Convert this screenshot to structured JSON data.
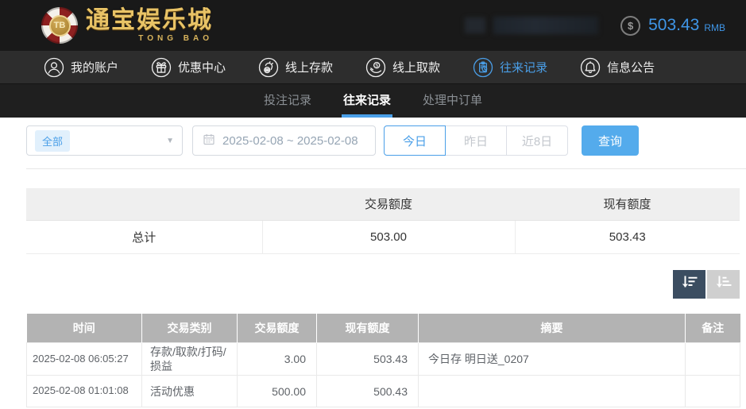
{
  "brand": {
    "chip_text": "TB",
    "name": "通宝娱乐城",
    "name_en": "TONG BAO"
  },
  "topbar": {
    "balance": "503.43",
    "currency": "RMB"
  },
  "nav": {
    "items": [
      {
        "label": "我的账户",
        "icon": "user-icon",
        "active": false
      },
      {
        "label": "优惠中心",
        "icon": "gift-icon",
        "active": false
      },
      {
        "label": "线上存款",
        "icon": "deposit-hand-coin-icon",
        "active": false
      },
      {
        "label": "线上取款",
        "icon": "withdraw-hand-coin-icon",
        "active": false
      },
      {
        "label": "往来记录",
        "icon": "transfer-records-icon",
        "active": true
      },
      {
        "label": "信息公告",
        "icon": "bell-icon",
        "active": false
      }
    ]
  },
  "subnav": {
    "tabs": [
      {
        "label": "投注记录",
        "active": false
      },
      {
        "label": "往来记录",
        "active": true
      },
      {
        "label": "处理中订单",
        "active": false
      }
    ]
  },
  "filters": {
    "type_select": {
      "value": "全部",
      "caret_icon": "caret-down-icon"
    },
    "date_range": {
      "value": "2025-02-08 ~ 2025-02-08",
      "icon": "calendar-icon"
    },
    "quick_ranges": [
      {
        "label": "今日",
        "active": true
      },
      {
        "label": "昨日",
        "active": false
      },
      {
        "label": "近8日",
        "active": false
      }
    ],
    "query_label": "查询"
  },
  "summary": {
    "headers": [
      "",
      "交易额度",
      "现有额度"
    ],
    "row": {
      "label": "总计",
      "transaction": "503.00",
      "balance": "503.43"
    }
  },
  "sort": {
    "icons": [
      "sort-desc-icon",
      "sort-asc-icon"
    ]
  },
  "records": {
    "headers": [
      "时间",
      "交易类别",
      "交易额度",
      "现有额度",
      "摘要",
      "备注"
    ],
    "rows": [
      {
        "time": "2025-02-08 06:05:27",
        "type": "存款/取款/打码/损益",
        "amount": "3.00",
        "balance": "503.43",
        "summary": "今日存 明日送_0207",
        "note": ""
      },
      {
        "time": "2025-02-08 01:01:08",
        "type": "活动优惠",
        "amount": "500.00",
        "balance": "500.43",
        "summary": "",
        "note": ""
      }
    ]
  },
  "colors": {
    "accent": "#4a9fe8",
    "query_button": "#54abec",
    "balance_text": "#3f96e8",
    "brand_gold": "#e8c366",
    "records_header_bg": "#b3b3b3",
    "sort_active_bg": "#3b4d61",
    "sort_inactive_bg": "#cfcfcf",
    "topbar_bg": "#191919",
    "navbar_bg": "#2d2d2d",
    "subnav_bg": "#1f1f1f"
  }
}
